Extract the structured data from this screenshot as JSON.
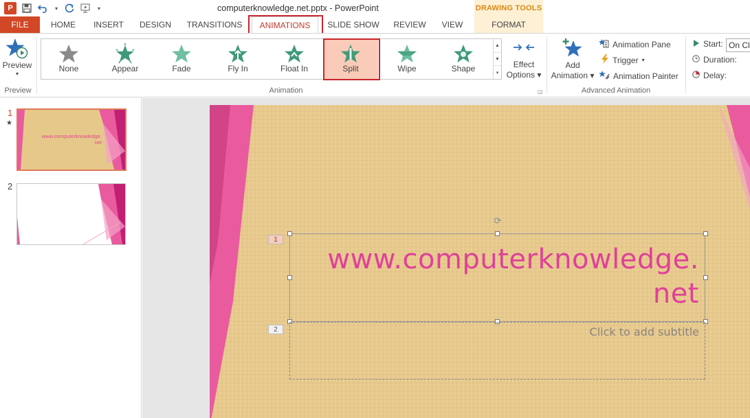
{
  "titlebar": {
    "title": "computerknowledge.net.pptx - PowerPoint",
    "app_icon_letter": "P",
    "contextual_header": "DRAWING TOOLS"
  },
  "tabs": [
    {
      "label": "FILE"
    },
    {
      "label": "HOME"
    },
    {
      "label": "INSERT"
    },
    {
      "label": "DESIGN"
    },
    {
      "label": "TRANSITIONS"
    },
    {
      "label": "ANIMATIONS"
    },
    {
      "label": "SLIDE SHOW"
    },
    {
      "label": "REVIEW"
    },
    {
      "label": "VIEW"
    },
    {
      "label": "FORMAT"
    }
  ],
  "ribbon": {
    "preview": {
      "label": "Preview",
      "group": "Preview"
    },
    "animation_group": "Animation",
    "animations": [
      {
        "label": "None",
        "color": "#8a8a8a"
      },
      {
        "label": "Appear",
        "color": "#3f9a78"
      },
      {
        "label": "Fade",
        "color": "#6fbfa0"
      },
      {
        "label": "Fly In",
        "color": "#3f9a78"
      },
      {
        "label": "Float In",
        "color": "#3f9a78"
      },
      {
        "label": "Split",
        "color": "#3f9a78"
      },
      {
        "label": "Wipe",
        "color": "#6fbfa0"
      },
      {
        "label": "Shape",
        "color": "#3f9a78"
      }
    ],
    "selected_animation": "Split",
    "effect_options": {
      "line1": "Effect",
      "line2": "Options"
    },
    "add_animation": {
      "line1": "Add",
      "line2": "Animation"
    },
    "advanced_group": "Advanced Animation",
    "animation_pane": "Animation Pane",
    "trigger": "Trigger",
    "animation_painter": "Animation Painter",
    "timing": {
      "start_label": "Start:",
      "start_value": "On Cli",
      "duration_label": "Duration:",
      "delay_label": "Delay:"
    }
  },
  "slides_pane": {
    "thumbs": [
      {
        "num": "1",
        "text_line1": "www.computerknowledge.",
        "text_line2": "net",
        "has_animation_marker": true
      },
      {
        "num": "2"
      }
    ],
    "animation_marker": "★"
  },
  "slide": {
    "title_line1": "www.computerknowledge.",
    "title_line2": "net",
    "subtitle_placeholder": "Click to add subtitle",
    "tag1": "1",
    "tag2": "2",
    "accent_color": "#e0409a"
  }
}
